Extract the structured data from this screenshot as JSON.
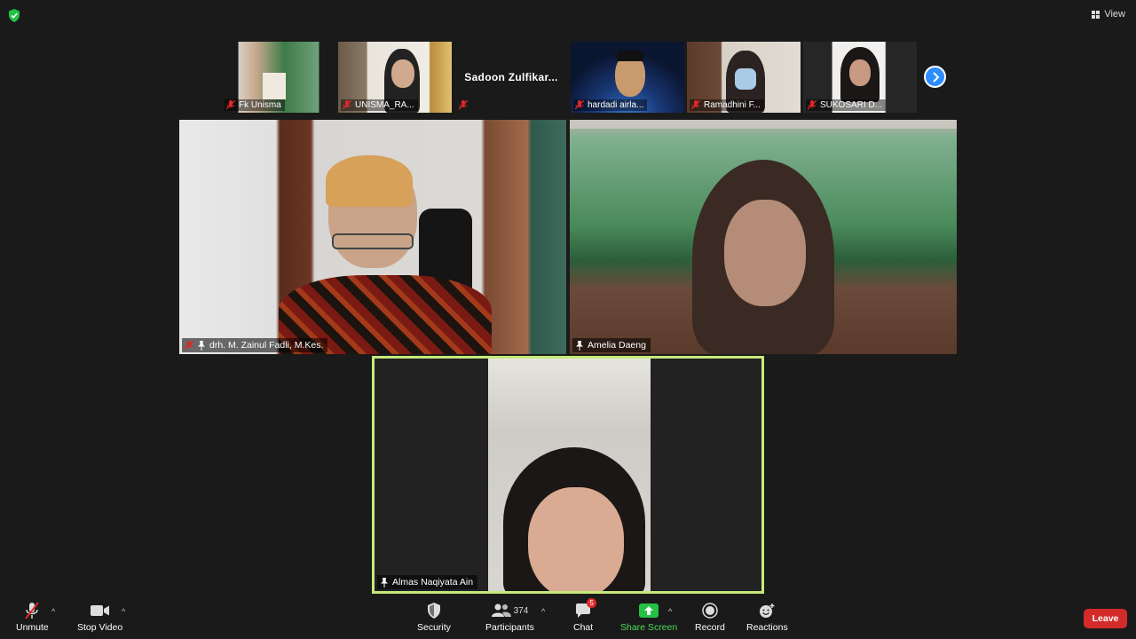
{
  "window": {
    "view_label": "View"
  },
  "thumbnails": [
    {
      "name": "Fk Unisma",
      "kind": "video"
    },
    {
      "name": "UNISMA_RA...",
      "kind": "video"
    },
    {
      "name": "Sadoon  Zulfikar...",
      "kind": "name-only"
    },
    {
      "name": "hardadi airla...",
      "kind": "video"
    },
    {
      "name": "Ramadhini F...",
      "kind": "video"
    },
    {
      "name": "SUKOSARI D...",
      "kind": "video"
    }
  ],
  "tiles": [
    {
      "name": "drh. M. Zainul Fadli, M.Kes.",
      "muted": true
    },
    {
      "name": "Amelia Daeng",
      "muted": false
    },
    {
      "name": "Almas Naqiyata Ain",
      "muted": false,
      "active_speaker": true
    }
  ],
  "toolbar": {
    "unmute_label": "Unmute",
    "stop_video_label": "Stop Video",
    "security_label": "Security",
    "participants_label": "Participants",
    "participants_count": "374",
    "chat_label": "Chat",
    "chat_badge": "5",
    "share_screen_label": "Share Screen",
    "record_label": "Record",
    "reactions_label": "Reactions",
    "leave_label": "Leave"
  },
  "colors": {
    "background": "#1a1a1a",
    "active_speaker_border": "#c6e97a",
    "share_green": "#23c244",
    "leave_red": "#d32a2a",
    "next_page_blue": "#2d8cff",
    "muted_red": "#e02828"
  },
  "icons": {
    "shield": "shield-check-icon",
    "view": "grid-view-icon",
    "mic_muted": "mic-muted-icon",
    "pin": "pin-icon",
    "next": "chevron-right-icon"
  }
}
